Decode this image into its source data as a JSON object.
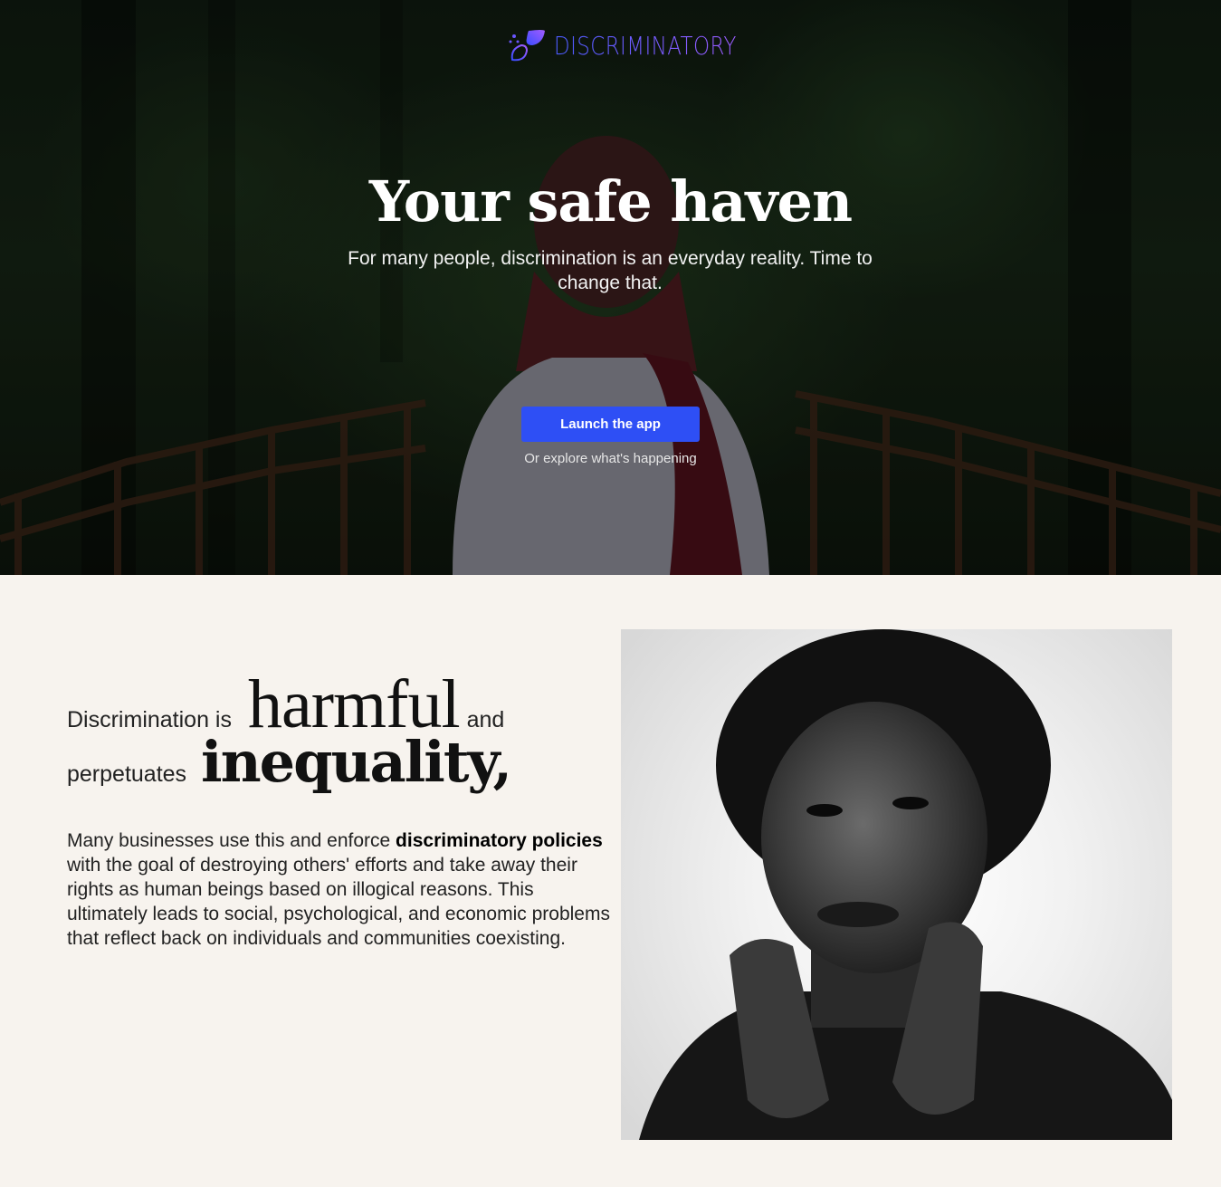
{
  "brand": {
    "name": "DISCRIMINATORY",
    "logo_icon": "leaf-dots-icon",
    "gradient_start": "#4b5bff",
    "gradient_end": "#9b5cff"
  },
  "hero": {
    "title": "Your safe haven",
    "subtitle": "For many people, discrimination is an everyday reality. Time to change that.",
    "cta_label": "Launch the app",
    "cta_color": "#2e4ff5",
    "secondary_link": "Or explore what's happening"
  },
  "statement": {
    "prefix_1": "Discrimination is",
    "emphasis_1": "harmful",
    "suffix_1": "and",
    "prefix_2": "perpetuates",
    "emphasis_2": "inequality,",
    "body_intro": "Many businesses use this and enforce ",
    "body_bold": "discriminatory policies",
    "body_rest": " with the goal of destroying others' efforts and take away their rights as human beings based on illogical reasons. This ultimately leads to social, psychological, and economic problems that reflect back on individuals and communities coexisting."
  },
  "colors": {
    "section_background": "#f7f3ee"
  }
}
